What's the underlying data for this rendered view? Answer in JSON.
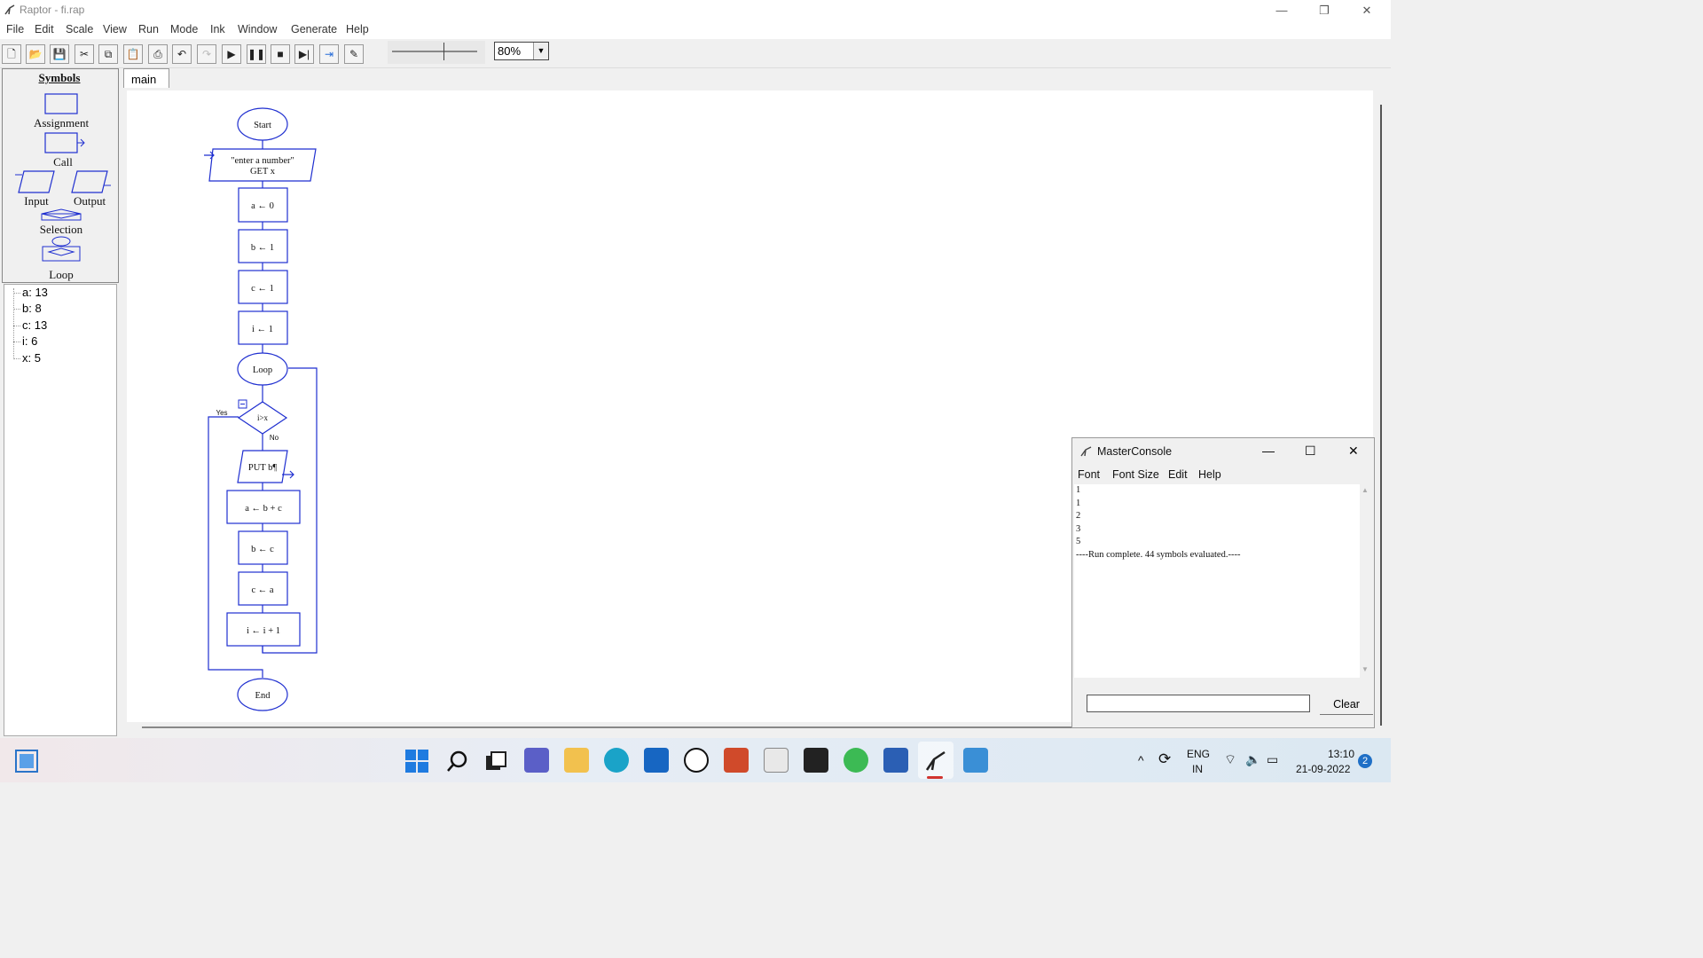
{
  "window": {
    "title": "Raptor - fi.rap"
  },
  "menu": [
    "File",
    "Edit",
    "Scale",
    "View",
    "Run",
    "Mode",
    "Ink",
    "Window",
    "Generate",
    "Help"
  ],
  "toolbar": {
    "zoom": "80%",
    "slider_level": 0.6
  },
  "symbols": {
    "header": "Symbols",
    "assignment": "Assignment",
    "call": "Call",
    "input": "Input",
    "output": "Output",
    "selection": "Selection",
    "loop": "Loop"
  },
  "variables": [
    {
      "text": "a: 13"
    },
    {
      "text": "b: 8"
    },
    {
      "text": "c: 13"
    },
    {
      "text": "i: 6"
    },
    {
      "text": "x: 5"
    }
  ],
  "tab": "main",
  "flowchart": {
    "start": "Start",
    "input_prompt": "\"enter a number\"",
    "input_get": "GET x",
    "a0": "a ← 0",
    "b1": "b ← 1",
    "c1": "c ← 1",
    "i1": "i ← 1",
    "loop": "Loop",
    "cond": "i>x",
    "yes": "Yes",
    "no": "No",
    "put": "PUT b¶",
    "abc": "a ← b + c",
    "bc": "b ← c",
    "ca": "c ← a",
    "inc": "i ← i + 1",
    "end": "End"
  },
  "console": {
    "title": "MasterConsole",
    "menu": [
      "Font",
      "Font Size",
      "Edit",
      "Help"
    ],
    "output": [
      "1",
      "1",
      "2",
      "3",
      "5",
      "----Run complete.  44 symbols evaluated.----"
    ],
    "clear": "Clear"
  },
  "taskbar": {
    "lang1": "ENG",
    "lang2": "IN",
    "time": "13:10",
    "date": "21-09-2022",
    "badge": "2"
  }
}
